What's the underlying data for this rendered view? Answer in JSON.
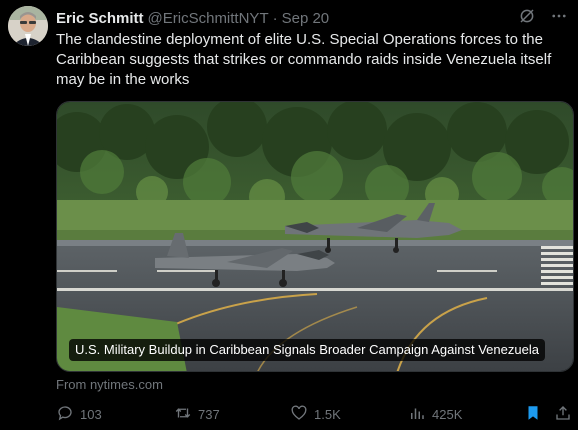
{
  "tweet": {
    "author_name": "Eric Schmitt",
    "author_handle": "@EricSchmittNYT",
    "separator": "·",
    "date": "Sep 20",
    "text": "The clandestine deployment of elite U.S. Special Operations forces to the Caribbean suggests that strikes or commando raids inside Venezuela itself may be in the works"
  },
  "card": {
    "caption": "U.S. Military Buildup in Caribbean Signals Broader Campaign Against Venezuela",
    "source": "From nytimes.com"
  },
  "actions": {
    "replies": "103",
    "reposts": "737",
    "likes": "1.5K",
    "views": "425K"
  },
  "icons": {
    "grok": "grok-icon",
    "more": "more-icon",
    "reply": "reply-icon",
    "repost": "repost-icon",
    "like": "heart-icon",
    "views": "views-icon",
    "bookmark": "bookmark-icon",
    "share": "share-icon"
  },
  "colors": {
    "background": "#000000",
    "text": "#e7e9ea",
    "muted": "#71767b",
    "accent": "#1d9bf0"
  }
}
